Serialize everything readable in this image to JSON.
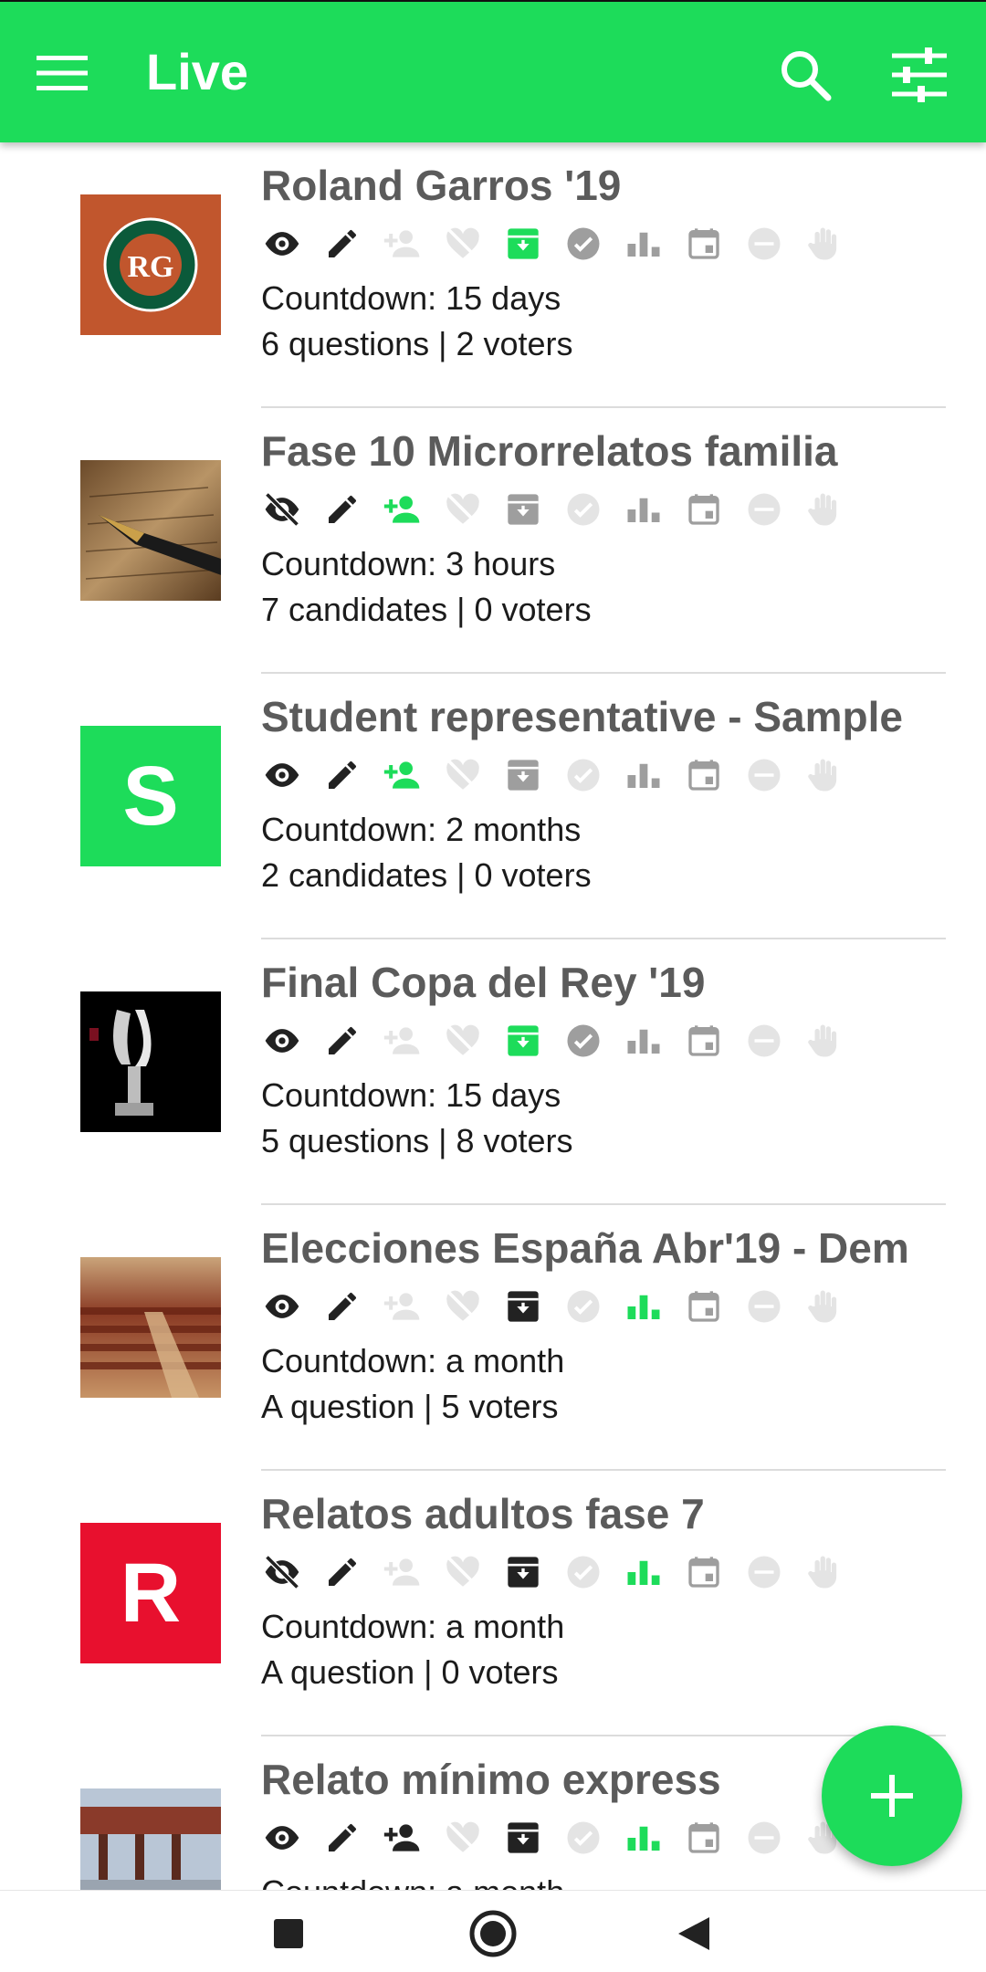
{
  "app_bar": {
    "title": "Live",
    "menu_icon": "menu-icon",
    "search_icon": "search-icon",
    "filter_icon": "tune-icon",
    "background": "#1ddc5a"
  },
  "colors": {
    "accent": "#1ddc5a",
    "icon_dark": "#222222",
    "icon_gray": "#9e9e9e",
    "icon_faded": "#e4e4e4",
    "title_text": "#5b5b5b"
  },
  "status_icon_names": [
    "visibility",
    "edit",
    "person-add",
    "heart",
    "archive",
    "check-circle",
    "bar-chart",
    "calendar",
    "minus-circle",
    "hand"
  ],
  "items": [
    {
      "name": "Roland Garros '19",
      "thumb": "roland-garros-logo",
      "line1": "Countdown: 15 days",
      "line2": "6 questions | 2 voters",
      "status": [
        "dark",
        "dark",
        "faded",
        "faded",
        "green-box",
        "gray",
        "gray",
        "gray",
        "faded",
        "faded"
      ]
    },
    {
      "name": "Fase 10 Microrrelatos familia",
      "thumb": "fountain-pen-photo",
      "line1": "Countdown: 3 hours",
      "line2": "7 candidates | 0 voters",
      "status": [
        "dark-off",
        "dark",
        "green",
        "faded",
        "gray-box",
        "faded",
        "gray",
        "gray",
        "faded",
        "faded"
      ]
    },
    {
      "name": "Student representative - Sample",
      "thumb": "letter",
      "thumb_letter": "S",
      "thumb_color": "#1ddc5a",
      "line1": "Countdown: 2 months",
      "line2": "2 candidates | 0 voters",
      "status": [
        "dark",
        "dark",
        "green",
        "faded",
        "gray-box",
        "faded",
        "gray",
        "gray",
        "faded",
        "faded"
      ]
    },
    {
      "name": "Final Copa del Rey '19",
      "thumb": "trophy-photo",
      "line1": "Countdown: 15 days",
      "line2": "5 questions | 8 voters",
      "status": [
        "dark",
        "dark",
        "faded",
        "faded",
        "green-box",
        "gray",
        "gray",
        "gray",
        "faded",
        "faded"
      ]
    },
    {
      "name": "Elecciones España Abr'19 - Dem",
      "thumb": "parliament-photo",
      "line1": "Countdown: a month",
      "line2": "A question | 5 voters",
      "status": [
        "dark",
        "dark",
        "faded",
        "faded",
        "dark-box",
        "faded",
        "green",
        "gray",
        "faded",
        "faded"
      ]
    },
    {
      "name": "Relatos adultos fase 7",
      "thumb": "letter",
      "thumb_letter": "R",
      "thumb_color": "#e8102e",
      "line1": "Countdown: a month",
      "line2": "A question | 0 voters",
      "status": [
        "dark-off",
        "dark",
        "faded",
        "faded",
        "dark-box",
        "faded",
        "green",
        "gray",
        "faded",
        "faded"
      ]
    },
    {
      "name": "Relato mínimo express",
      "thumb": "building-photo",
      "line1": "Countdown: a month",
      "line2": "",
      "status": [
        "dark",
        "dark",
        "dark",
        "faded",
        "dark-box",
        "faded",
        "green",
        "gray",
        "faded",
        "faded"
      ]
    }
  ],
  "fab": {
    "icon": "plus-icon"
  },
  "system_nav": {
    "icons": [
      "recents-square-icon",
      "home-circle-icon",
      "back-triangle-icon"
    ]
  }
}
